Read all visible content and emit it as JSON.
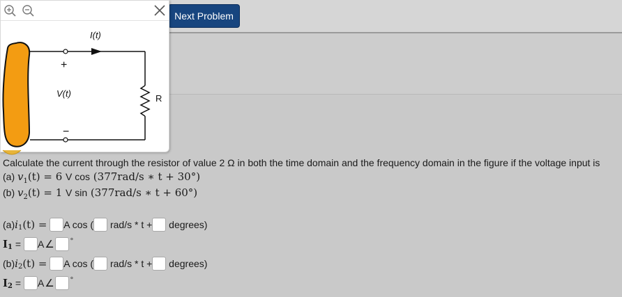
{
  "toolbar": {
    "next_label": "Next Problem"
  },
  "figure": {
    "current_label": "I(t)",
    "plus_label": "+",
    "voltage_label": "V(t)",
    "minus_label": "−",
    "resistor_label": "R"
  },
  "question": {
    "prompt": "Calculate the current through the resistor of value 2 Ω in both the time domain and the frequency domain in the figure if the voltage input is",
    "part_a_prefix": "(a) ",
    "part_a_lhs": "v",
    "part_a_sub": "1",
    "part_a_mid": "(t) = 6 ",
    "part_a_unit": "V cos",
    "part_a_arg": " (377rad/s ∗ t + 30°)",
    "part_b_prefix": "(b) ",
    "part_b_lhs": "v",
    "part_b_sub": "2",
    "part_b_mid": "(t) = 1 ",
    "part_b_unit": "V sin",
    "part_b_arg": " (377rad/s ∗ t + 60°)"
  },
  "answers": {
    "row1": {
      "prefix": "(a) ",
      "var": "i",
      "sub": "1",
      "suffix": "(t) =",
      "cos_label": "A cos (",
      "rads_label": "rad/s * t +",
      "deg_label": "degrees)"
    },
    "row2": {
      "var": "I",
      "sub": "1",
      "eq": "=",
      "unit": "A",
      "angle": "∠",
      "deg": "°"
    },
    "row3": {
      "prefix": "(b) ",
      "var": "i",
      "sub": "2",
      "suffix": "(t) =",
      "cos_label": "A cos (",
      "rads_label": "rad/s * t +",
      "deg_label": "degrees)"
    },
    "row4": {
      "var": "I",
      "sub": "2",
      "eq": "=",
      "unit": "A",
      "angle": "∠",
      "deg": "°"
    }
  },
  "icons": [
    "zoom-in-icon",
    "zoom-out-icon",
    "close-icon"
  ],
  "colors": {
    "button": "#17457f",
    "source": "#f39c12",
    "page_bg": "#c9c9c9"
  }
}
